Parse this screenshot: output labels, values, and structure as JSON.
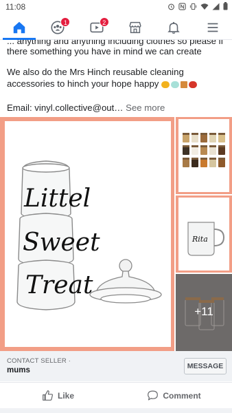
{
  "status_bar": {
    "time": "11:08",
    "icons": [
      "alarm-icon",
      "nfc-icon",
      "vibrate-icon",
      "wifi-icon",
      "signal-icon",
      "battery-icon"
    ]
  },
  "nav": {
    "tabs": [
      {
        "name": "home",
        "icon": "home-icon",
        "active": true,
        "badge": ""
      },
      {
        "name": "groups",
        "icon": "groups-icon",
        "active": false,
        "badge": "1"
      },
      {
        "name": "watch",
        "icon": "video-icon",
        "active": false,
        "badge": "2"
      },
      {
        "name": "marketplace",
        "icon": "shop-icon",
        "active": false,
        "badge": ""
      },
      {
        "name": "notifications",
        "icon": "bell-icon",
        "active": false,
        "badge": ""
      },
      {
        "name": "menu",
        "icon": "menu-icon",
        "active": false,
        "badge": ""
      }
    ],
    "active_color": "#1877f2",
    "badge_color": "#e41e3f"
  },
  "post": {
    "line_partial": "... anything and anything including clothes so please if",
    "line_1": "there something you have in mind we can create",
    "paragraph_2": "We also do the Mrs Hinch reusable cleaning accessories to hinch your hope happy",
    "emojis": [
      "sponge-emoji",
      "soap-emoji",
      "broom-emoji",
      "basket-emoji"
    ],
    "email_prefix": "Email: vinyl.collective@out…",
    "see_more": "See more"
  },
  "gallery": {
    "main_image_text": [
      "Littel",
      "Sweet",
      "Treat"
    ],
    "thumb2_text": "Rita",
    "more_count": "+11",
    "frame_color": "#f29e86"
  },
  "seller": {
    "label": "CONTACT SELLER ·",
    "name": "mums",
    "message_button": "MESSAGE"
  },
  "actions": {
    "like": "Like",
    "comment": "Comment"
  }
}
